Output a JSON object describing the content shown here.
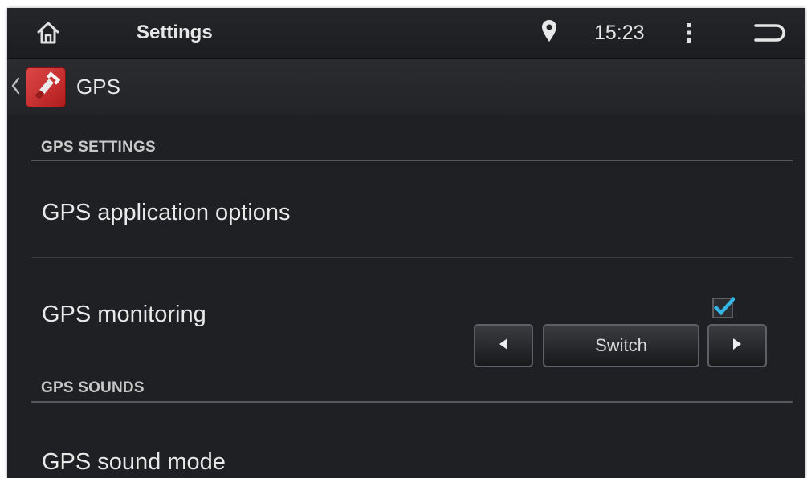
{
  "status_bar": {
    "title": "Settings",
    "time": "15:23",
    "icons": [
      "home-icon",
      "location-pin-icon",
      "overflow-menu-icon",
      "back-icon"
    ]
  },
  "action_bar": {
    "title": "GPS",
    "icons": [
      "up-chevron-icon",
      "settings-wrench-icon"
    ]
  },
  "sections": [
    {
      "header": "GPS SETTINGS",
      "items": [
        {
          "title": "GPS application options"
        },
        {
          "title": "GPS monitoring",
          "checked": true
        }
      ]
    },
    {
      "header": "GPS SOUNDS",
      "items": [
        {
          "title": "GPS sound mode",
          "control": {
            "prev_icon": "arrow-left-icon",
            "label": "Switch",
            "next_icon": "arrow-right-icon"
          }
        }
      ]
    }
  ],
  "colors": {
    "background": "#1f2023",
    "checkbox_accent": "#33b5e5",
    "app_icon": "#c62828"
  }
}
